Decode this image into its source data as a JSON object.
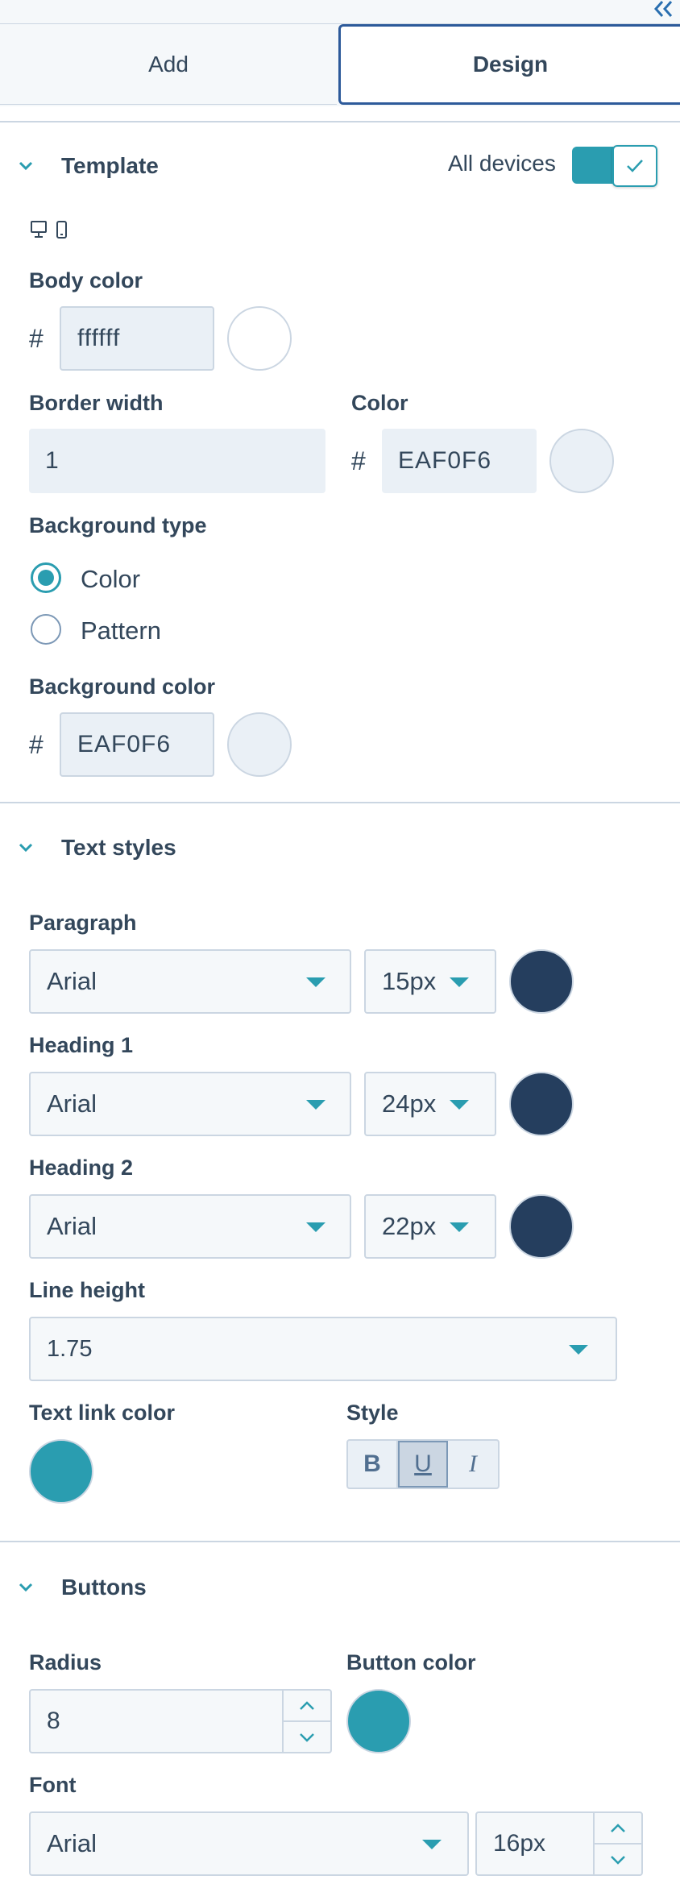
{
  "tabs": {
    "add": "Add",
    "design": "Design"
  },
  "template": {
    "title": "Template",
    "all_devices_label": "All devices",
    "body_color_label": "Body color",
    "body_color_value": "ffffff",
    "body_color_swatch": "#ffffff",
    "border_width_label": "Border width",
    "border_width_value": "1",
    "color_label": "Color",
    "color_value": "EAF0F6",
    "color_swatch": "#eaf0f6",
    "background_type_label": "Background type",
    "background_type_options": [
      "Color",
      "Pattern"
    ],
    "background_type_selected": "Color",
    "background_color_label": "Background color",
    "background_color_value": "EAF0F6",
    "background_color_swatch": "#eaf0f6",
    "hash": "#"
  },
  "text_styles": {
    "title": "Text styles",
    "paragraph_label": "Paragraph",
    "paragraph_font": "Arial",
    "paragraph_size": "15px",
    "heading1_label": "Heading 1",
    "heading1_font": "Arial",
    "heading1_size": "24px",
    "heading2_label": "Heading 2",
    "heading2_font": "Arial",
    "heading2_size": "22px",
    "text_color_swatch": "#253e5e",
    "line_height_label": "Line height",
    "line_height_value": "1.75",
    "text_link_color_label": "Text link color",
    "text_link_color_swatch": "#2a9db0",
    "style_label": "Style",
    "style_bold": "B",
    "style_underline": "U",
    "style_italic": "I"
  },
  "buttons": {
    "title": "Buttons",
    "radius_label": "Radius",
    "radius_value": "8",
    "button_color_label": "Button color",
    "button_color_swatch": "#2a9db0",
    "font_label": "Font",
    "font_value": "Arial",
    "font_size_value": "16px"
  },
  "colors": {
    "accent": "#2a9db0",
    "text": "#33475b",
    "border": "#cbd6e2",
    "dark_navy": "#253e5e"
  }
}
